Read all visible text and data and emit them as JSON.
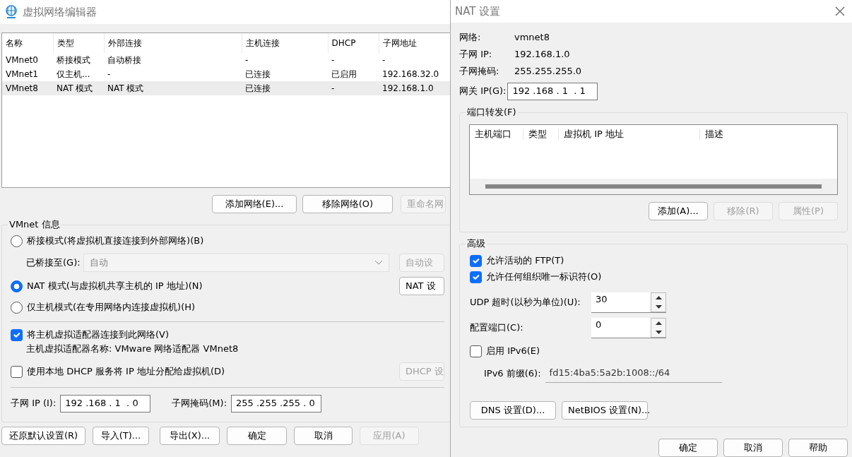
{
  "editor": {
    "title": "虚拟网络编辑器",
    "table": {
      "columns": [
        "名称",
        "类型",
        "外部连接",
        "主机连接",
        "DHCP",
        "子网地址"
      ],
      "rows": [
        {
          "cells": [
            "VMnet0",
            "桥接模式",
            "自动桥接",
            "-",
            "-",
            "-"
          ],
          "selected": false
        },
        {
          "cells": [
            "VMnet1",
            "仅主机...",
            "-",
            "已连接",
            "已启用",
            "192.168.32.0"
          ],
          "selected": false
        },
        {
          "cells": [
            "VMnet8",
            "NAT 模式",
            "NAT 模式",
            "已连接",
            "-",
            "192.168.1.0"
          ],
          "selected": true
        }
      ]
    },
    "table_buttons": [
      {
        "label": "添加网络(E)...",
        "disabled": false
      },
      {
        "label": "移除网络(O)",
        "disabled": false
      },
      {
        "label": "重命名网",
        "disabled": true
      }
    ],
    "info": {
      "title": "VMnet 信息",
      "modes": [
        {
          "label": "桥接模式(将虚拟机直接连接到外部网络)(B)",
          "selected": false
        },
        {
          "label": "NAT 模式(与虚拟机共享主机的 IP 地址)(N)",
          "selected": true
        },
        {
          "label": "仅主机模式(在专用网络内连接虚拟机)(H)",
          "selected": false
        }
      ],
      "bridged_to": {
        "label": "已桥接至(G):",
        "value": "自动",
        "disabled": true
      },
      "auto_button": {
        "label": "自动设",
        "disabled": true
      },
      "nat_button": {
        "label": "NAT 设",
        "disabled": false
      },
      "connect_adapter": {
        "label": "将主机虚拟适配器连接到此网络(V)",
        "checked": true
      },
      "adapter_name": "主机虚拟适配器名称: VMware 网络适配器 VMnet8",
      "dhcp": {
        "label": "使用本地 DHCP 服务将 IP 地址分配给虚拟机(D)",
        "checked": false
      },
      "dhcp_button": {
        "label": "DHCP 设",
        "disabled": true
      },
      "subnet_ip": {
        "label": "子网 IP (I):",
        "value": "192 .168 . 1  . 0"
      },
      "subnet_mask": {
        "label": "子网掩码(M):",
        "value": "255 .255 .255 . 0"
      }
    },
    "bottom_buttons": [
      {
        "label": "还原默认设置(R)",
        "disabled": false
      },
      {
        "label": "导入(T)...",
        "disabled": false
      },
      {
        "label": "导出(X)...",
        "disabled": false
      },
      {
        "label": "确定",
        "disabled": false
      },
      {
        "label": "取消",
        "disabled": false
      },
      {
        "label": "应用(A)",
        "disabled": true
      }
    ]
  },
  "nat_dialog": {
    "title": "NAT 设置",
    "fields": [
      {
        "label": "网络:",
        "value": "vmnet8"
      },
      {
        "label": "子网 IP:",
        "value": "192.168.1.0"
      },
      {
        "label": "子网掩码:",
        "value": "255.255.255.0"
      }
    ],
    "gateway": {
      "label": "网关 IP(G):",
      "value": "192 .168 . 1  . 1"
    },
    "port_forwarding": {
      "title": "端口转发(F)",
      "columns": [
        "主机端口",
        "类型",
        "虚拟机 IP 地址",
        "描述"
      ],
      "buttons": [
        {
          "label": "添加(A)...",
          "disabled": false
        },
        {
          "label": "移除(R)",
          "disabled": true
        },
        {
          "label": "属性(P)",
          "disabled": true
        }
      ]
    },
    "advanced": {
      "title": "高级",
      "options": [
        {
          "label": "允许活动的 FTP(T)",
          "checked": true
        },
        {
          "label": "允许任何组织唯一标识符(O)",
          "checked": true
        }
      ],
      "spinners": [
        {
          "label": "UDP 超时(以秒为单位)(U):",
          "value": "30"
        },
        {
          "label": "配置端口(C):",
          "value": "0"
        }
      ],
      "ipv6": {
        "label": "启用 IPv6(E)",
        "checked": false
      },
      "prefix": {
        "label": "IPv6 前缀(6):",
        "value": "fd15:4ba5:5a2b:1008::/64",
        "disabled": true
      },
      "buttons": [
        {
          "label": "DNS 设置(D)...",
          "disabled": false
        },
        {
          "label": "NetBIOS 设置(N)...",
          "disabled": false
        }
      ]
    },
    "buttons": [
      {
        "label": "确定",
        "disabled": false
      },
      {
        "label": "取消",
        "disabled": false
      },
      {
        "label": "帮助",
        "disabled": false
      }
    ]
  }
}
